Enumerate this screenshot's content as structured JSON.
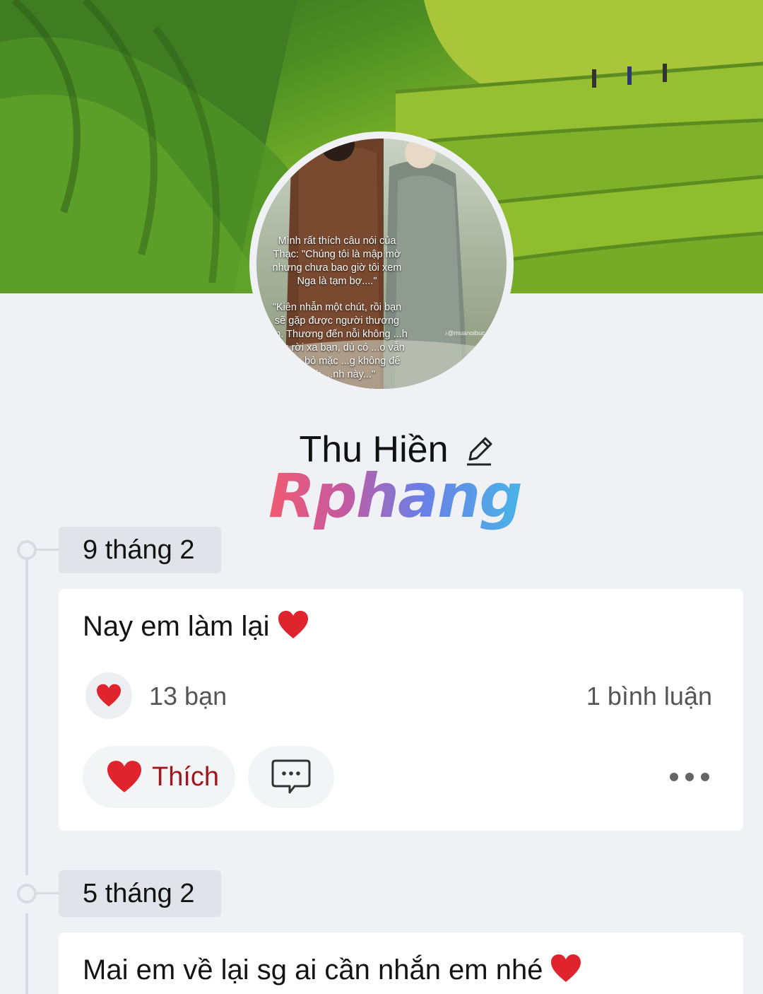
{
  "profile": {
    "name": "Thu Hiền",
    "avatar_caption_1": "Mình rất thích câu nói của Thạc: \"Chúng tôi là mập mờ nhưng chưa bao giờ tôi xem Nga là tạm bợ....\"",
    "avatar_caption_2": "\"Kiên nhẫn một chút, rồi bạn sẽ gặp được người thương ...n. Thương đến nỗi không ...h lòng rời xa bạn, dù có ...o vẫn không bỏ mặc ...g không để đánh ...nh này...\"",
    "avatar_handle": "♪@muanoibuc"
  },
  "watermark": "Rphang",
  "posts": [
    {
      "date": "9 tháng 2",
      "text": "Nay em làm lại",
      "reaction_count": "13 bạn",
      "comment_count": "1 bình luận",
      "like_label": "Thích"
    },
    {
      "date": "5 tháng 2",
      "text": "Mai em về lại sg ai cần nhắn em nhé"
    }
  ],
  "icons": {
    "edit": "pencil-icon",
    "heart": "heart-icon",
    "comment": "comment-icon",
    "more": "more-icon"
  },
  "colors": {
    "background": "#eff1f5",
    "heart": "#e0242d",
    "like_label": "#a1171f",
    "date_chip": "#e0e4ea"
  }
}
